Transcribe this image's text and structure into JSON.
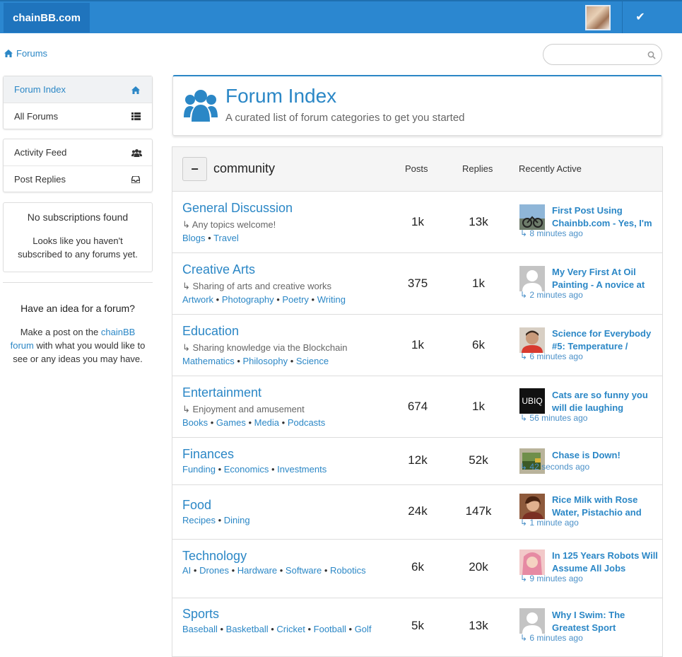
{
  "brand": "chainBB.com",
  "breadcrumb": "Forums",
  "search": {
    "placeholder": ""
  },
  "sidebar": {
    "nav": [
      {
        "label": "Forum Index",
        "icon": "home-icon"
      },
      {
        "label": "All Forums",
        "icon": "list-icon"
      }
    ],
    "nav2": [
      {
        "label": "Activity Feed",
        "icon": "users-icon"
      },
      {
        "label": "Post Replies",
        "icon": "inbox-icon"
      }
    ],
    "no_subs_title": "No subscriptions found",
    "no_subs_text": "Looks like you haven't subscribed to any forums yet.",
    "idea_title": "Have an idea for a forum?",
    "idea_text_pre": "Make a post on the ",
    "idea_link": "chainBB forum",
    "idea_text_post": " with what you would like to see or any ideas you may have."
  },
  "header": {
    "title": "Forum Index",
    "subtitle": "A curated list of forum categories to get you started"
  },
  "table": {
    "category": "community",
    "collapse_label": "−",
    "columns": {
      "posts": "Posts",
      "replies": "Replies",
      "recent": "Recently Active"
    },
    "rows": [
      {
        "name": "General Discussion",
        "desc": "↳ Any topics welcome!",
        "tags": [
          "Blogs",
          "Travel"
        ],
        "posts": "1k",
        "replies": "13k",
        "recent_title": "First Post Using Chainbb.com - Yes, I'm",
        "recent_time": "↳ 8 minutes ago"
      },
      {
        "name": "Creative Arts",
        "desc": "↳ Sharing of arts and creative works",
        "tags": [
          "Artwork",
          "Photography",
          "Poetry",
          "Writing"
        ],
        "posts": "375",
        "replies": "1k",
        "recent_title": "My Very First At Oil Painting - A novice at",
        "recent_time": "↳ 2 minutes ago"
      },
      {
        "name": "Education",
        "desc": "↳ Sharing knowledge via the Blockchain",
        "tags": [
          "Mathematics",
          "Philosophy",
          "Science"
        ],
        "posts": "1k",
        "replies": "6k",
        "recent_title": "Science for Everybody #5: Temperature /",
        "recent_time": "↳ 6 minutes ago"
      },
      {
        "name": "Entertainment",
        "desc": "↳ Enjoyment and amusement",
        "tags": [
          "Books",
          "Games",
          "Media",
          "Podcasts"
        ],
        "posts": "674",
        "replies": "1k",
        "recent_title": "Cats are so funny you will die laughing",
        "recent_time": "↳ 56 minutes ago"
      },
      {
        "name": "Finances",
        "desc": "",
        "tags": [
          "Funding",
          "Economics",
          "Investments"
        ],
        "posts": "12k",
        "replies": "52k",
        "recent_title": "Chase is Down!",
        "recent_time": "↳ 42 seconds ago"
      },
      {
        "name": "Food",
        "desc": "",
        "tags": [
          "Recipes",
          "Dining"
        ],
        "posts": "24k",
        "replies": "147k",
        "recent_title": "Rice Milk with Rose Water, Pistachio and",
        "recent_time": "↳ 1 minute ago"
      },
      {
        "name": "Technology",
        "desc": "",
        "tags": [
          "AI",
          "Drones",
          "Hardware",
          "Software",
          "Robotics"
        ],
        "posts": "6k",
        "replies": "20k",
        "recent_title": "In 125 Years Robots Will Assume All Jobs",
        "recent_time": "↳ 9 minutes ago"
      },
      {
        "name": "Sports",
        "desc": "",
        "tags": [
          "Baseball",
          "Basketball",
          "Cricket",
          "Football",
          "Golf"
        ],
        "posts": "5k",
        "replies": "13k",
        "recent_title": "Why I Swim: The Greatest Sport",
        "recent_time": "↳ 6 minutes ago"
      }
    ]
  },
  "avatar_labels": {
    "entertainment": "UBIQ"
  }
}
